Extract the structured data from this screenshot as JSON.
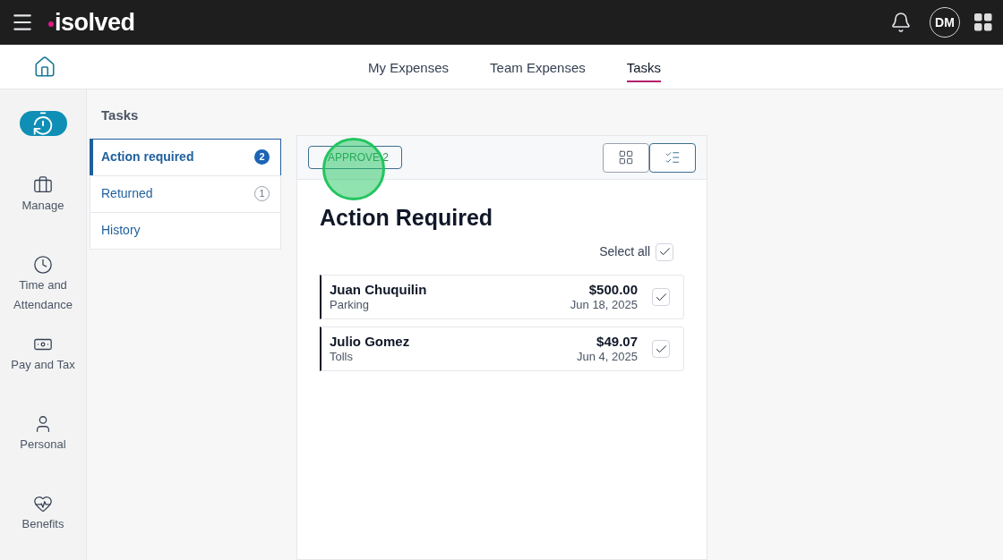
{
  "header": {
    "logo": "isolved",
    "avatar": "DM"
  },
  "nav_tabs": [
    {
      "label": "My Expenses",
      "selected": false
    },
    {
      "label": "Team Expenses",
      "selected": false
    },
    {
      "label": "Tasks",
      "selected": true
    }
  ],
  "rail": [
    {
      "label": "Manage",
      "kind": "briefcase"
    },
    {
      "label": "Time and Attendance",
      "kind": "clock"
    },
    {
      "label": "Pay and Tax",
      "kind": "money"
    },
    {
      "label": "Personal",
      "kind": "person"
    },
    {
      "label": "Benefits",
      "kind": "heart"
    }
  ],
  "tasks_panel": {
    "title": "Tasks",
    "items": [
      {
        "label": "Action required",
        "count": "2",
        "selected": true
      },
      {
        "label": "Returned",
        "count": "1",
        "selected": false
      },
      {
        "label": "History",
        "selected": false
      }
    ]
  },
  "main": {
    "approve_button": "APPROVE 2",
    "view_toggle": [
      {
        "kind": "grid",
        "selected": false
      },
      {
        "kind": "list",
        "selected": true
      }
    ],
    "title": "Action Required",
    "select_all": {
      "label": "Select all",
      "checked": true
    },
    "rows": [
      {
        "name": "Juan Chuquilin",
        "category": "Parking",
        "amount": "$500.00",
        "date": "Jun 18, 2025",
        "checked": true
      },
      {
        "name": "Julio Gomez",
        "category": "Tolls",
        "amount": "$49.07",
        "date": "Jun 4, 2025",
        "checked": true
      }
    ]
  }
}
